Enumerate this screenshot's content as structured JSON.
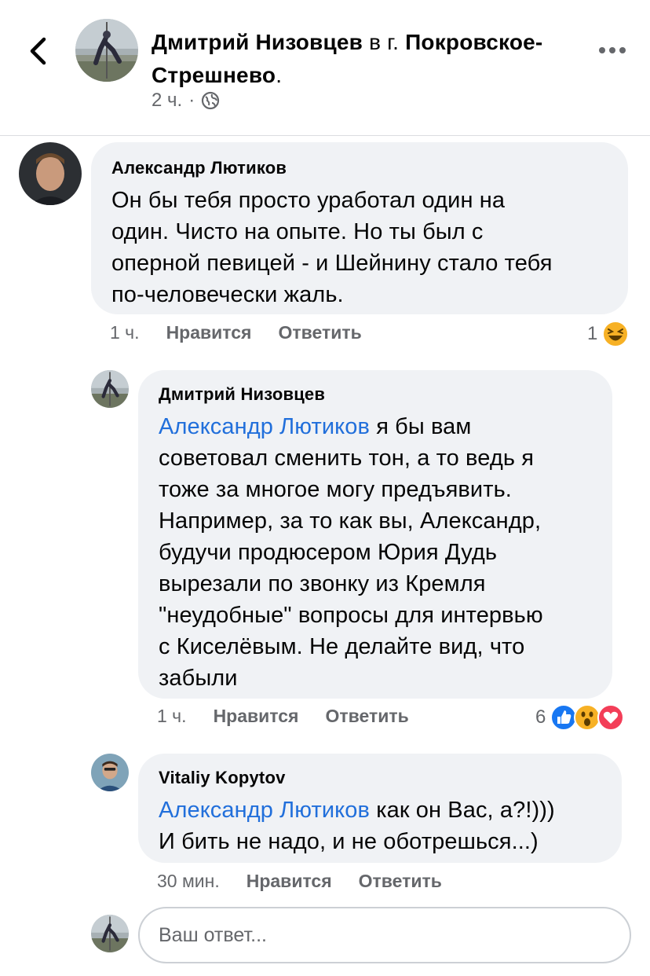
{
  "header": {
    "author": "Дмитрий Низовцев",
    "location_prefix": "в г.",
    "location": "Покровское-Стрешнево",
    "location_suffix": ".",
    "time": "2 ч.",
    "separator": "·",
    "icons": {
      "back": "chevron-left-icon",
      "privacy": "globe-icon",
      "more": "more-horizontal-icon"
    }
  },
  "comments": [
    {
      "author": "Александр Лютиков",
      "text": "Он бы тебя просто уработал один на\nодин. Чисто на опыте. Но ты был с\nоперной певицей - и Шейнину стало тебя\nпо-человечески жаль.",
      "time": "1 ч.",
      "like": "Нравится",
      "reply": "Ответить",
      "reaction_count": "1",
      "reactions": [
        "haha"
      ]
    },
    {
      "author": "Дмитрий Низовцев",
      "mention": "Александр Лютиков",
      "text_first": " я бы вам",
      "text": "советовал сменить тон, а то ведь я\nтоже за многое могу предъявить.\nНапример, за то как вы, Александр,\nбудучи продюсером Юрия Дудь\nвырезали по звонку из Кремля\n\"неудобные\" вопросы для интервью\nс Киселёвым. Не делайте вид, что\nзабыли",
      "time": "1 ч.",
      "like": "Нравится",
      "reply": "Ответить",
      "reaction_count": "6",
      "reactions": [
        "like",
        "wow",
        "love"
      ]
    },
    {
      "author": "Vitaliy Kopytov",
      "mention": "Александр Лютиков",
      "text_first": " как он Вас, а?!)))",
      "text": "И бить не надо, и не оботрешься...)",
      "time": "30 мин.",
      "like": "Нравится",
      "reply": "Ответить"
    }
  ],
  "reply_box": {
    "placeholder": "Ваш ответ..."
  },
  "colors": {
    "link": "#216fdb",
    "bubble": "#f0f2f5",
    "secondary": "#65676b",
    "like": "#1877f2",
    "love": "#f33e58",
    "haha": "#f7b125"
  }
}
